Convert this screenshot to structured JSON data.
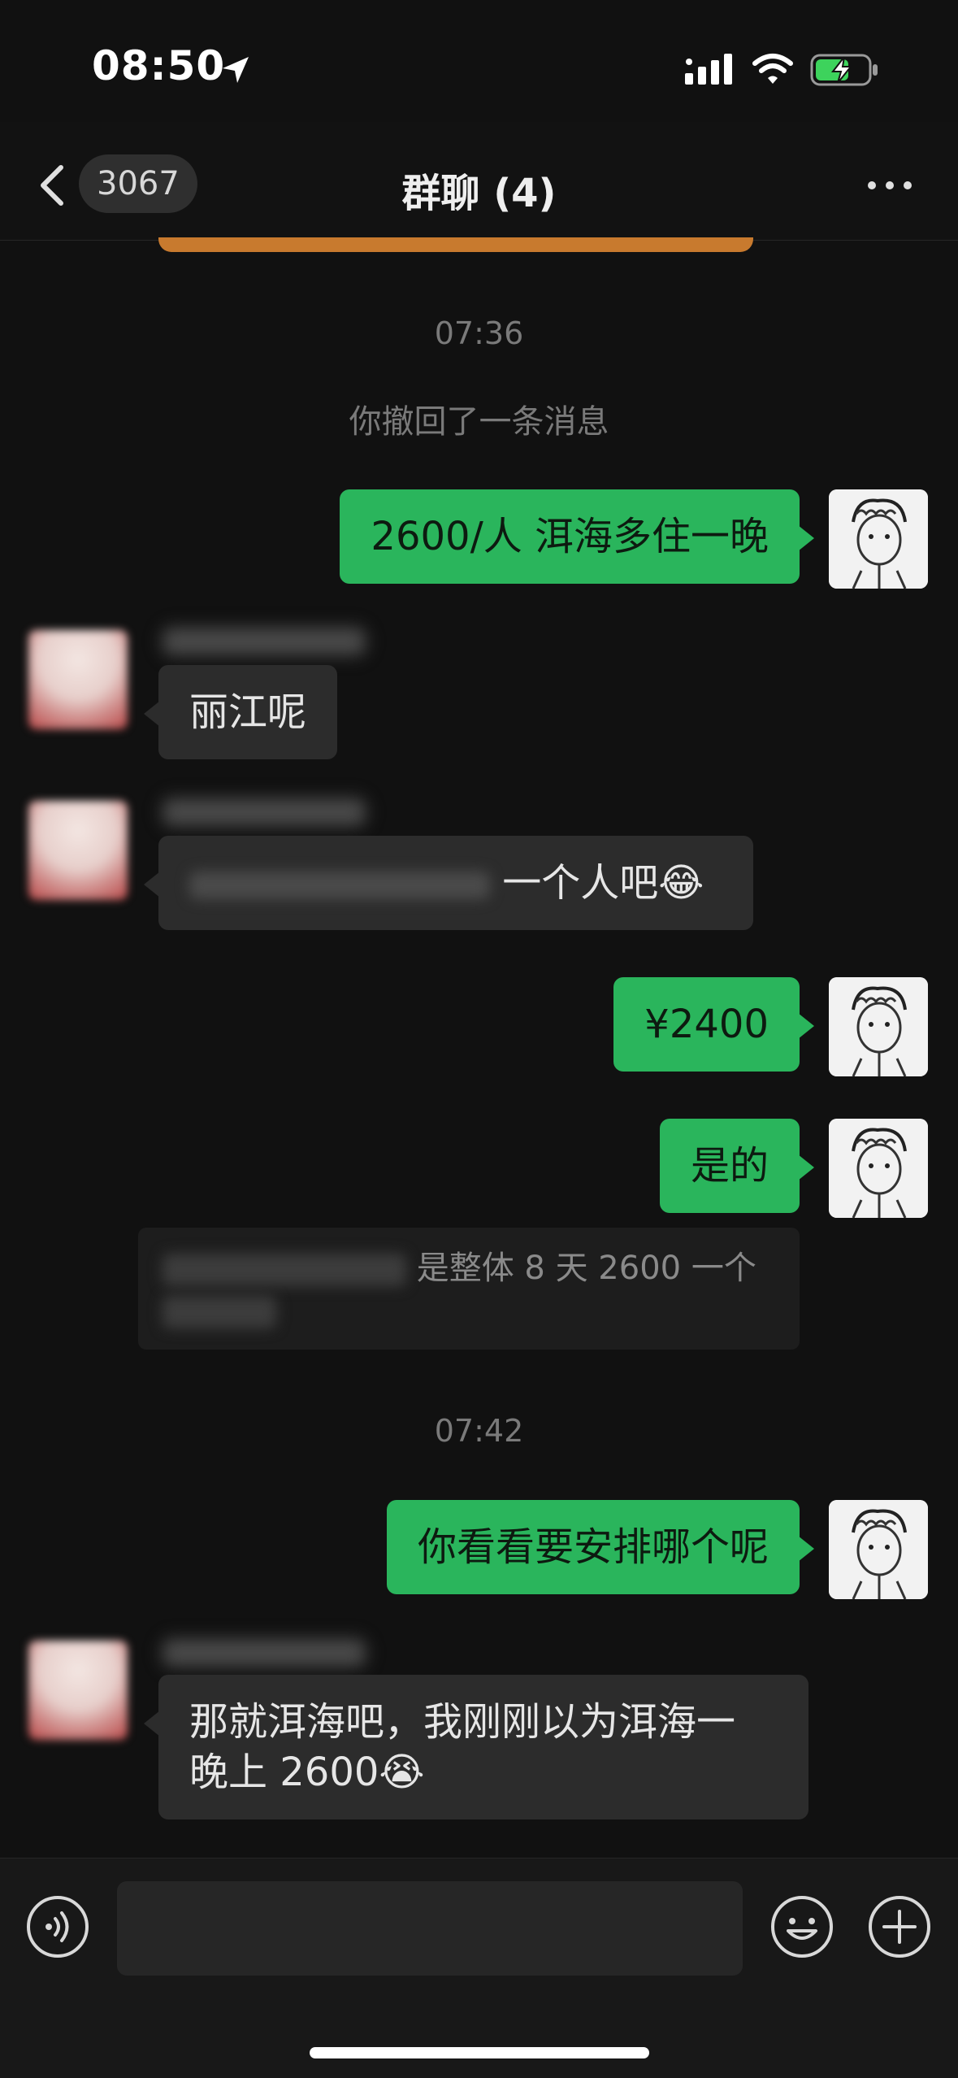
{
  "status_bar": {
    "time": "08:50",
    "icons": [
      "location-arrow-icon",
      "signal-icon",
      "wifi-icon",
      "battery-charging-icon"
    ]
  },
  "nav": {
    "back_count": "3067",
    "title": "群聊 (4)",
    "icons": [
      "chevron-left-icon",
      "more-icon"
    ]
  },
  "chat": {
    "timestamps": [
      "07:36",
      "07:42"
    ],
    "system_notice": "你撤回了一条消息",
    "messages": [
      {
        "direction": "outgoing",
        "text": "2600/人 洱海多住一晚"
      },
      {
        "direction": "incoming",
        "text": "丽江呢"
      },
      {
        "direction": "incoming",
        "text": "一个人吧",
        "emoji": "😂"
      },
      {
        "direction": "outgoing",
        "text": "¥2400"
      },
      {
        "direction": "outgoing",
        "text": "是的"
      },
      {
        "direction": "quote",
        "text": "是整体 8 天 2600 一个"
      },
      {
        "direction": "outgoing",
        "text": "你看看要安排哪个呢"
      },
      {
        "direction": "incoming",
        "text_line1": "那就洱海吧，我刚刚以为洱海一",
        "text_line2": "晚上 2600",
        "emoji": "😭"
      }
    ]
  },
  "input_bar": {
    "placeholder": "",
    "icons": [
      "voice-icon",
      "emoji-icon",
      "plus-icon"
    ]
  },
  "colors": {
    "background": "#111111",
    "outgoing_bubble": "#2ab55c",
    "incoming_bubble": "#2c2c2c",
    "muted_text": "#7a7a7a"
  }
}
